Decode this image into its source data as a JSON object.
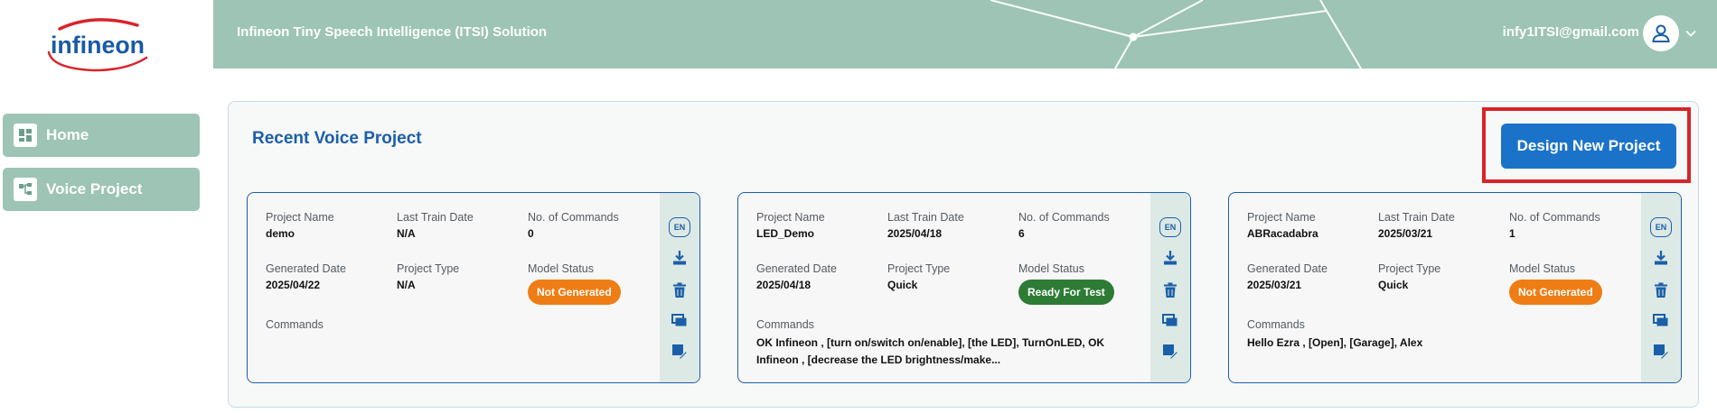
{
  "brand": {
    "logo_text": "infineon",
    "accent": "#9dc4b5",
    "primary": "#1b73c9",
    "highlight": "#d8232a"
  },
  "sidebar": {
    "items": [
      {
        "label": "Home",
        "icon": "dashboard-icon"
      },
      {
        "label": "Voice Project",
        "icon": "hierarchy-icon"
      }
    ]
  },
  "header": {
    "title": "Infineon Tiny Speech Intelligence (ITSI) Solution",
    "user_email": "infy1ITSI@gmail.com"
  },
  "main": {
    "title": "Recent Voice Project",
    "design_button": "Design New Project",
    "field_labels": {
      "project_name": "Project Name",
      "last_train_date": "Last Train Date",
      "num_commands": "No. of Commands",
      "generated_date": "Generated Date",
      "project_type": "Project Type",
      "model_status": "Model Status",
      "commands": "Commands"
    },
    "projects": [
      {
        "project_name": "demo",
        "last_train_date": "N/A",
        "num_commands": "0",
        "generated_date": "2025/04/22",
        "project_type": "N/A",
        "model_status": "Not Generated",
        "status_color": "#ef7d15",
        "commands": "",
        "lang": "EN"
      },
      {
        "project_name": "LED_Demo",
        "last_train_date": "2025/04/18",
        "num_commands": "6",
        "generated_date": "2025/04/18",
        "project_type": "Quick",
        "model_status": "Ready For Test",
        "status_color": "#2d7b35",
        "commands": "OK Infineon , [turn on/switch on/enable], [the LED], TurnOnLED, OK Infineon , [decrease the LED brightness/make...",
        "lang": "EN"
      },
      {
        "project_name": "ABRacadabra",
        "last_train_date": "2025/03/21",
        "num_commands": "1",
        "generated_date": "2025/03/21",
        "project_type": "Quick",
        "model_status": "Not Generated",
        "status_color": "#ef7d15",
        "commands": "Hello Ezra , [Open], [Garage], Alex",
        "lang": "EN"
      }
    ]
  }
}
